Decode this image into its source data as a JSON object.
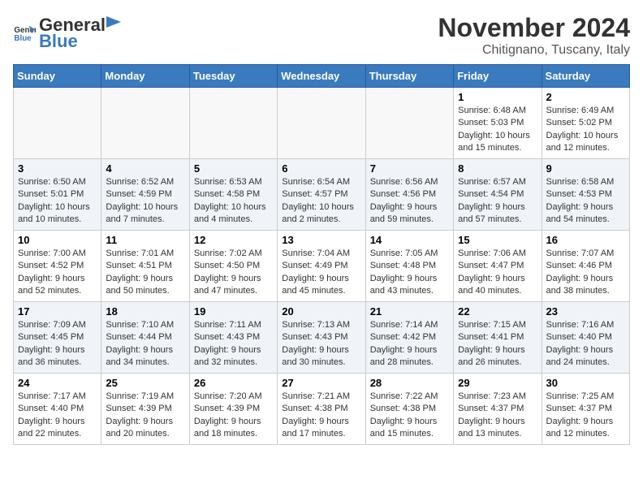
{
  "logo": {
    "general": "General",
    "blue": "Blue"
  },
  "title": "November 2024",
  "location": "Chitignano, Tuscany, Italy",
  "weekdays": [
    "Sunday",
    "Monday",
    "Tuesday",
    "Wednesday",
    "Thursday",
    "Friday",
    "Saturday"
  ],
  "weeks": [
    [
      {
        "day": "",
        "info": ""
      },
      {
        "day": "",
        "info": ""
      },
      {
        "day": "",
        "info": ""
      },
      {
        "day": "",
        "info": ""
      },
      {
        "day": "",
        "info": ""
      },
      {
        "day": "1",
        "info": "Sunrise: 6:48 AM\nSunset: 5:03 PM\nDaylight: 10 hours and 15 minutes."
      },
      {
        "day": "2",
        "info": "Sunrise: 6:49 AM\nSunset: 5:02 PM\nDaylight: 10 hours and 12 minutes."
      }
    ],
    [
      {
        "day": "3",
        "info": "Sunrise: 6:50 AM\nSunset: 5:01 PM\nDaylight: 10 hours and 10 minutes."
      },
      {
        "day": "4",
        "info": "Sunrise: 6:52 AM\nSunset: 4:59 PM\nDaylight: 10 hours and 7 minutes."
      },
      {
        "day": "5",
        "info": "Sunrise: 6:53 AM\nSunset: 4:58 PM\nDaylight: 10 hours and 4 minutes."
      },
      {
        "day": "6",
        "info": "Sunrise: 6:54 AM\nSunset: 4:57 PM\nDaylight: 10 hours and 2 minutes."
      },
      {
        "day": "7",
        "info": "Sunrise: 6:56 AM\nSunset: 4:56 PM\nDaylight: 9 hours and 59 minutes."
      },
      {
        "day": "8",
        "info": "Sunrise: 6:57 AM\nSunset: 4:54 PM\nDaylight: 9 hours and 57 minutes."
      },
      {
        "day": "9",
        "info": "Sunrise: 6:58 AM\nSunset: 4:53 PM\nDaylight: 9 hours and 54 minutes."
      }
    ],
    [
      {
        "day": "10",
        "info": "Sunrise: 7:00 AM\nSunset: 4:52 PM\nDaylight: 9 hours and 52 minutes."
      },
      {
        "day": "11",
        "info": "Sunrise: 7:01 AM\nSunset: 4:51 PM\nDaylight: 9 hours and 50 minutes."
      },
      {
        "day": "12",
        "info": "Sunrise: 7:02 AM\nSunset: 4:50 PM\nDaylight: 9 hours and 47 minutes."
      },
      {
        "day": "13",
        "info": "Sunrise: 7:04 AM\nSunset: 4:49 PM\nDaylight: 9 hours and 45 minutes."
      },
      {
        "day": "14",
        "info": "Sunrise: 7:05 AM\nSunset: 4:48 PM\nDaylight: 9 hours and 43 minutes."
      },
      {
        "day": "15",
        "info": "Sunrise: 7:06 AM\nSunset: 4:47 PM\nDaylight: 9 hours and 40 minutes."
      },
      {
        "day": "16",
        "info": "Sunrise: 7:07 AM\nSunset: 4:46 PM\nDaylight: 9 hours and 38 minutes."
      }
    ],
    [
      {
        "day": "17",
        "info": "Sunrise: 7:09 AM\nSunset: 4:45 PM\nDaylight: 9 hours and 36 minutes."
      },
      {
        "day": "18",
        "info": "Sunrise: 7:10 AM\nSunset: 4:44 PM\nDaylight: 9 hours and 34 minutes."
      },
      {
        "day": "19",
        "info": "Sunrise: 7:11 AM\nSunset: 4:43 PM\nDaylight: 9 hours and 32 minutes."
      },
      {
        "day": "20",
        "info": "Sunrise: 7:13 AM\nSunset: 4:43 PM\nDaylight: 9 hours and 30 minutes."
      },
      {
        "day": "21",
        "info": "Sunrise: 7:14 AM\nSunset: 4:42 PM\nDaylight: 9 hours and 28 minutes."
      },
      {
        "day": "22",
        "info": "Sunrise: 7:15 AM\nSunset: 4:41 PM\nDaylight: 9 hours and 26 minutes."
      },
      {
        "day": "23",
        "info": "Sunrise: 7:16 AM\nSunset: 4:40 PM\nDaylight: 9 hours and 24 minutes."
      }
    ],
    [
      {
        "day": "24",
        "info": "Sunrise: 7:17 AM\nSunset: 4:40 PM\nDaylight: 9 hours and 22 minutes."
      },
      {
        "day": "25",
        "info": "Sunrise: 7:19 AM\nSunset: 4:39 PM\nDaylight: 9 hours and 20 minutes."
      },
      {
        "day": "26",
        "info": "Sunrise: 7:20 AM\nSunset: 4:39 PM\nDaylight: 9 hours and 18 minutes."
      },
      {
        "day": "27",
        "info": "Sunrise: 7:21 AM\nSunset: 4:38 PM\nDaylight: 9 hours and 17 minutes."
      },
      {
        "day": "28",
        "info": "Sunrise: 7:22 AM\nSunset: 4:38 PM\nDaylight: 9 hours and 15 minutes."
      },
      {
        "day": "29",
        "info": "Sunrise: 7:23 AM\nSunset: 4:37 PM\nDaylight: 9 hours and 13 minutes."
      },
      {
        "day": "30",
        "info": "Sunrise: 7:25 AM\nSunset: 4:37 PM\nDaylight: 9 hours and 12 minutes."
      }
    ]
  ]
}
